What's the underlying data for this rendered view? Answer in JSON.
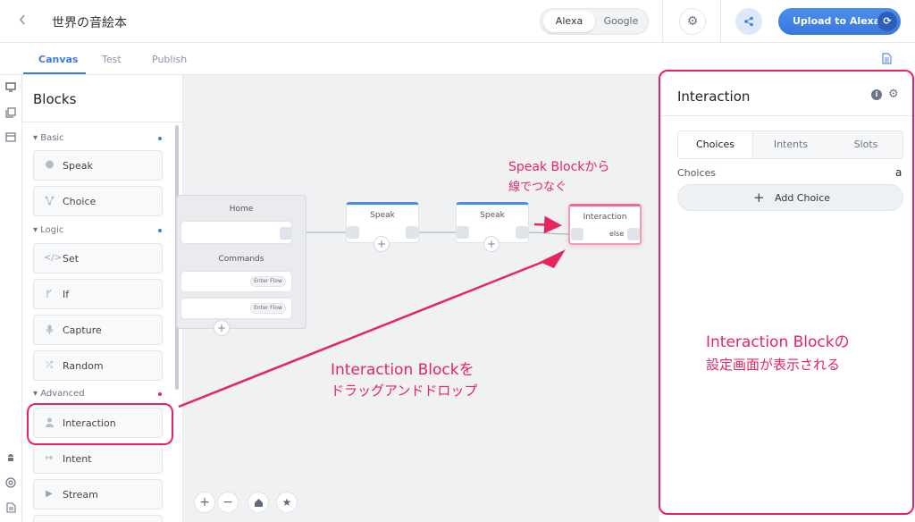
{
  "header": {
    "back_icon": "chevron-left-icon",
    "project_title": "世界の音絵本",
    "platform_options": [
      "Alexa",
      "Google"
    ],
    "platform_selected": "Alexa",
    "settings_icon": "gear-icon",
    "share_icon": "share-icon",
    "upload_label": "Upload to Alexa",
    "upload_icon": "sync-icon"
  },
  "tabs": {
    "canvas": "Canvas",
    "test": "Test",
    "publish": "Publish",
    "active": "Canvas",
    "doc_icon": "document-icon"
  },
  "rail": {
    "icons": [
      "monitor-icon",
      "library-icon",
      "window-icon",
      "android-icon",
      "help-ring-icon",
      "notes-icon"
    ]
  },
  "blocks_panel": {
    "title": "Blocks",
    "categories": [
      {
        "label": "Basic",
        "dot_color": "#3b7ddd",
        "items": [
          {
            "label": "Speak",
            "icon": "speech-bubble-icon"
          },
          {
            "label": "Choice",
            "icon": "branch-icon"
          }
        ]
      },
      {
        "label": "Logic",
        "dot_color": "#3b7ddd",
        "items": [
          {
            "label": "Set",
            "icon": "code-icon"
          },
          {
            "label": "If",
            "icon": "fork-icon"
          },
          {
            "label": "Capture",
            "icon": "microphone-icon"
          },
          {
            "label": "Random",
            "icon": "shuffle-icon"
          }
        ]
      },
      {
        "label": "Advanced",
        "dot_color": "#e8245e",
        "items": [
          {
            "label": "Interaction",
            "icon": "user-icon"
          },
          {
            "label": "Intent",
            "icon": "arrow-into-icon"
          },
          {
            "label": "Stream",
            "icon": "play-icon"
          }
        ]
      }
    ]
  },
  "canvas": {
    "home_node": {
      "title": "Home",
      "commands_label": "Commands",
      "enter_flow": "Enter Flow"
    },
    "speak_nodes": [
      {
        "title": "Speak"
      },
      {
        "title": "Speak"
      }
    ],
    "interaction_node": {
      "title": "Interaction",
      "else_label": "else"
    },
    "zoom_controls": [
      "zoom-in-icon",
      "zoom-out-icon",
      "home-icon",
      "star-icon"
    ]
  },
  "right_panel": {
    "title": "Interaction",
    "info_icon": "info-icon",
    "gear_icon": "gear-icon",
    "tabs": [
      "Choices",
      "Intents",
      "Slots"
    ],
    "active_tab": "Choices",
    "choices_label": "Choices",
    "a_icon": "a",
    "add_choice_label": "Add Choice"
  },
  "annotations": {
    "speak_connect_line1": "Speak Blockから",
    "speak_connect_line2": "線でつなぐ",
    "drag_line1": "Interaction Blockを",
    "drag_line2": "ドラッグアンドドロップ",
    "panel_line1": "Interaction Blockの",
    "panel_line2": "設定画面が表示される",
    "color": "#e8245e"
  }
}
